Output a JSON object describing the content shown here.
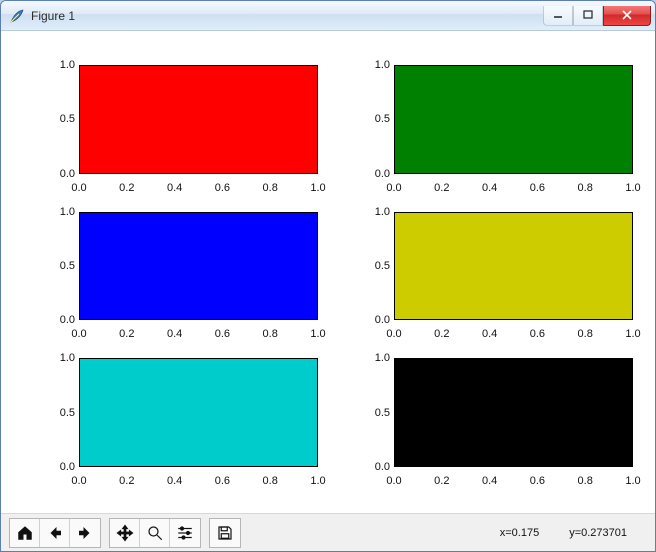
{
  "window": {
    "title": "Figure 1"
  },
  "toolbar": {
    "home": "Home",
    "back": "Back",
    "forward": "Forward",
    "pan": "Pan",
    "zoom": "Zoom",
    "config": "Configure subplots",
    "save": "Save"
  },
  "status": {
    "x_label": "x=0.175",
    "y_label": "y=0.273701"
  },
  "ticks": {
    "x": [
      "0.0",
      "0.2",
      "0.4",
      "0.6",
      "0.8",
      "1.0"
    ],
    "y": [
      "0.0",
      "0.5",
      "1.0"
    ]
  },
  "colors": {
    "red": "#ff0000",
    "green": "#008000",
    "blue": "#0000ff",
    "yellow": "#cccc00",
    "cyan": "#00cccc",
    "black": "#000000"
  },
  "chart_data": [
    {
      "type": "area",
      "fill_color": "red",
      "xlim": [
        0,
        1
      ],
      "ylim": [
        0,
        1
      ],
      "x": [
        0,
        1
      ],
      "y": [
        1,
        1
      ],
      "xticks": [
        0,
        0.2,
        0.4,
        0.6,
        0.8,
        1
      ],
      "yticks": [
        0,
        0.5,
        1
      ]
    },
    {
      "type": "area",
      "fill_color": "green",
      "xlim": [
        0,
        1
      ],
      "ylim": [
        0,
        1
      ],
      "x": [
        0,
        1
      ],
      "y": [
        1,
        1
      ],
      "xticks": [
        0,
        0.2,
        0.4,
        0.6,
        0.8,
        1
      ],
      "yticks": [
        0,
        0.5,
        1
      ]
    },
    {
      "type": "area",
      "fill_color": "blue",
      "xlim": [
        0,
        1
      ],
      "ylim": [
        0,
        1
      ],
      "x": [
        0,
        1
      ],
      "y": [
        1,
        1
      ],
      "xticks": [
        0,
        0.2,
        0.4,
        0.6,
        0.8,
        1
      ],
      "yticks": [
        0,
        0.5,
        1
      ]
    },
    {
      "type": "area",
      "fill_color": "yellow",
      "xlim": [
        0,
        1
      ],
      "ylim": [
        0,
        1
      ],
      "x": [
        0,
        1
      ],
      "y": [
        1,
        1
      ],
      "xticks": [
        0,
        0.2,
        0.4,
        0.6,
        0.8,
        1
      ],
      "yticks": [
        0,
        0.5,
        1
      ]
    },
    {
      "type": "area",
      "fill_color": "cyan",
      "xlim": [
        0,
        1
      ],
      "ylim": [
        0,
        1
      ],
      "x": [
        0,
        1
      ],
      "y": [
        1,
        1
      ],
      "xticks": [
        0,
        0.2,
        0.4,
        0.6,
        0.8,
        1
      ],
      "yticks": [
        0,
        0.5,
        1
      ]
    },
    {
      "type": "area",
      "fill_color": "black",
      "xlim": [
        0,
        1
      ],
      "ylim": [
        0,
        1
      ],
      "x": [
        0,
        1
      ],
      "y": [
        1,
        1
      ],
      "xticks": [
        0,
        0.2,
        0.4,
        0.6,
        0.8,
        1
      ],
      "yticks": [
        0,
        0.5,
        1
      ]
    }
  ]
}
